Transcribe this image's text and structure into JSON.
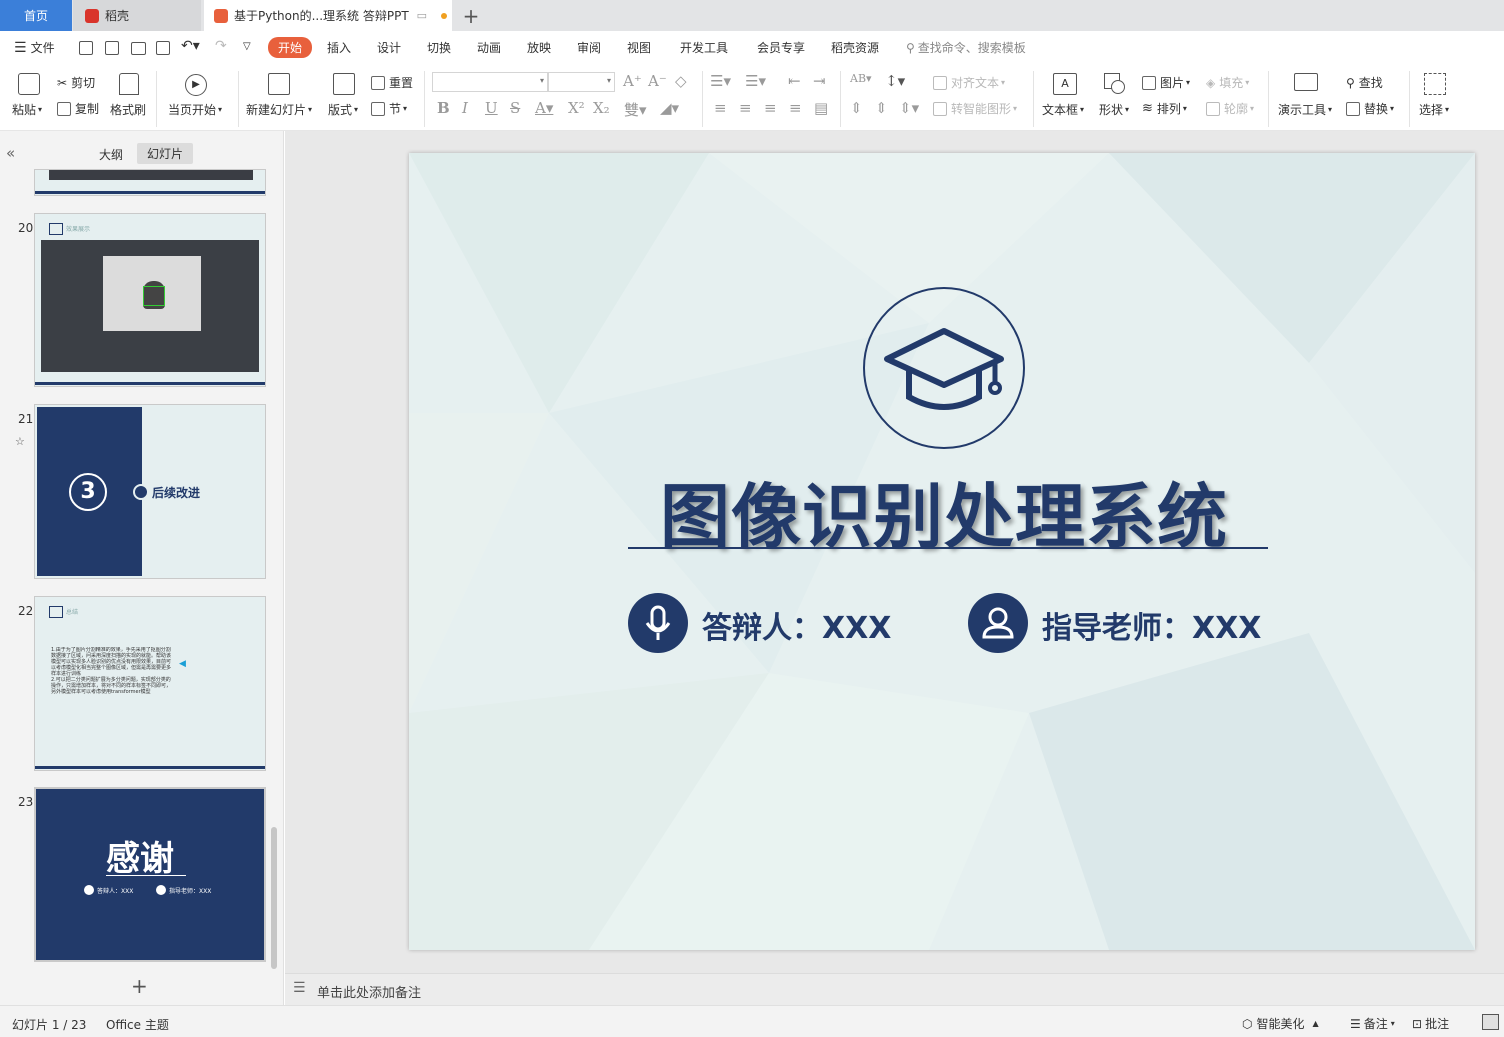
{
  "tabs": {
    "home": "首页",
    "docer": "稻壳",
    "document": "基于Python的...理系统 答辩PPT",
    "new_tab": "+"
  },
  "menu": {
    "file": "文件",
    "items": [
      "开始",
      "插入",
      "设计",
      "切换",
      "动画",
      "放映",
      "审阅",
      "视图",
      "开发工具",
      "会员专享",
      "稻壳资源"
    ],
    "search_placeholder": "查找命令、搜索模板"
  },
  "ribbon": {
    "paste": "粘贴",
    "cut": "剪切",
    "copy": "复制",
    "format_painter": "格式刷",
    "from_start": "当页开始",
    "new_slide": "新建幻灯片",
    "layout": "版式",
    "reset": "重置",
    "section": "节",
    "align_text": "对齐文本",
    "smart_shape": "转智能图形",
    "textbox": "文本框",
    "shape": "形状",
    "picture": "图片",
    "arrange": "排列",
    "fill": "填充",
    "outline": "轮廓",
    "present_tools": "演示工具",
    "find": "查找",
    "replace": "替换",
    "select": "选择"
  },
  "panel": {
    "tab_outline": "大纲",
    "tab_slides": "幻灯片",
    "slide_numbers": [
      "20",
      "21",
      "22",
      "23"
    ],
    "slide20_header": "效果展示",
    "slide21_number": "3",
    "slide21_title": "后续改进",
    "slide22_header": "总结",
    "slide22_text": "1.由于为了图片分割精准的效果，手先采用了抠图分割数据接了区域，问采用深度扫描的实现的就能。帮助该模型可以实现多人脸识别的优点没有用限效果，目前可以考虑模型化相当完整个图像区域，但需是再需要更多样本进行训练\n2.可以把二分类问题扩展为多分类问题，实现部分类的操作，只需增加样本，将对不同的样本标签不同即可，另外模型样本可以考虑使用transformer模型",
    "slide23_title": "感谢",
    "slide23_presenter": "答辩人：XXX",
    "slide23_advisor": "指导老师：XXX",
    "add_slide": "+"
  },
  "slide": {
    "title": "图像识别处理系统",
    "presenter_label": "答辩人：XXX",
    "advisor_label": "指导老师：XXX"
  },
  "notes_placeholder": "单击此处添加备注",
  "status": {
    "slide_counter": "幻灯片 1 / 23",
    "theme": "Office 主题",
    "beautify": "智能美化",
    "notes": "备注",
    "comment": "批注"
  },
  "colors": {
    "accent": "#e8603c",
    "home_tab": "#3b7fd9",
    "navy": "#223a6a"
  }
}
